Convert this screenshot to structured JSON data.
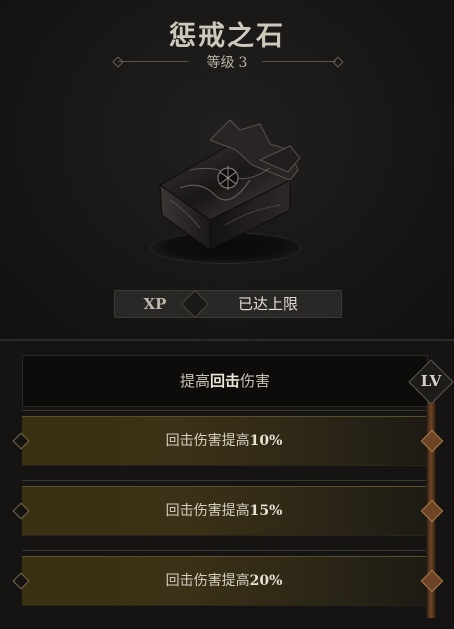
{
  "title": "惩戒之石",
  "level": {
    "label": "等级",
    "value": "3"
  },
  "item": {
    "icon": "dark-stone-cube-icon"
  },
  "xp": {
    "label": "XP",
    "status": "已达上限"
  },
  "passive": {
    "prefix": "提高",
    "highlight": "回击",
    "suffix": "伤害",
    "badge": "LV"
  },
  "tiers": [
    {
      "text": "回击伤害提高",
      "percent": "10%"
    },
    {
      "text": "回击伤害提高",
      "percent": "15%"
    },
    {
      "text": "回击伤害提高",
      "percent": "20%"
    }
  ]
}
